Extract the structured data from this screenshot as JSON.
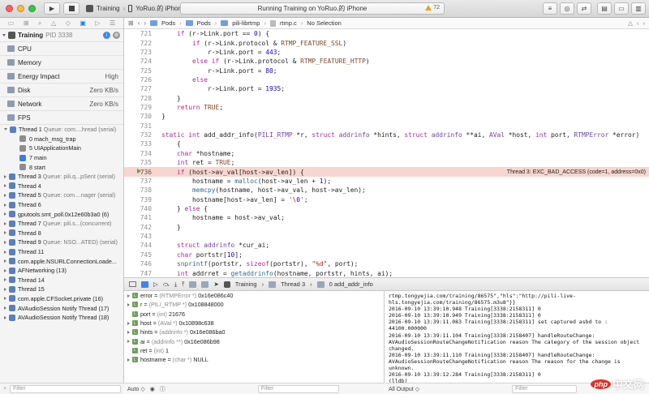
{
  "toolbar": {
    "scheme": "Training",
    "device": "YoRuo.的 iPhone",
    "status": "Running Training on YoRuo.的 iPhone",
    "warnings": "72"
  },
  "sidebar": {
    "process_name": "Training",
    "process_pid": "PID 3338",
    "gauges": [
      {
        "label": "CPU",
        "value": ""
      },
      {
        "label": "Memory",
        "value": ""
      },
      {
        "label": "Energy Impact",
        "value": "High"
      },
      {
        "label": "Disk",
        "value": "Zero KB/s"
      },
      {
        "label": "Network",
        "value": "Zero KB/s"
      },
      {
        "label": "FPS",
        "value": ""
      }
    ],
    "thread1": {
      "label": "Thread 1",
      "queue": "Queue: com....hread (serial)"
    },
    "frames": [
      {
        "label": "0 mach_msg_trap"
      },
      {
        "label": "5 UIApplicationMain"
      },
      {
        "label": "7 main"
      },
      {
        "label": "8 start"
      }
    ],
    "threads": [
      {
        "label": "Thread 3",
        "queue": "Queue: pili.q...pSent (serial)"
      },
      {
        "label": "Thread 4",
        "queue": ""
      },
      {
        "label": "Thread 5",
        "queue": "Queue: com....nager (serial)"
      },
      {
        "label": "Thread 6",
        "queue": ""
      },
      {
        "label": "gputools.smt_poll.0x12e60b3a0 (6)",
        "queue": ""
      },
      {
        "label": "Thread 7",
        "queue": "Queue: pili.s...(concurrent)"
      },
      {
        "label": "Thread 8",
        "queue": ""
      },
      {
        "label": "Thread 9",
        "queue": "Queue: NSO...ATED) (serial)"
      },
      {
        "label": "Thread 11",
        "queue": ""
      },
      {
        "label": "com.apple.NSURLConnectionLoade...",
        "queue": ""
      },
      {
        "label": "AFNetworking (13)",
        "queue": ""
      },
      {
        "label": "Thread 14",
        "queue": ""
      },
      {
        "label": "Thread 15",
        "queue": ""
      },
      {
        "label": "com.apple.CFSocket.private (16)",
        "queue": ""
      },
      {
        "label": "AVAudioSession Notify Thread (17)",
        "queue": ""
      },
      {
        "label": "AVAudioSession Notify Thread (18)",
        "queue": ""
      }
    ],
    "filter_placeholder": "Filter"
  },
  "jumpbar": {
    "path": [
      "Pods",
      "Pods",
      "pili-librtmp",
      "rtmp.c",
      "No Selection"
    ]
  },
  "code": {
    "crash_note": "Thread 3: EXC_BAD_ACCESS (code=1, address=0x0)",
    "lines": [
      {
        "n": "721",
        "t": "    if (r->Link.port == 0) {"
      },
      {
        "n": "722",
        "t": "        if (r->Link.protocol & RTMP_FEATURE_SSL)"
      },
      {
        "n": "723",
        "t": "            r->Link.port = 443;"
      },
      {
        "n": "724",
        "t": "        else if (r->Link.protocol & RTMP_FEATURE_HTTP)"
      },
      {
        "n": "725",
        "t": "            r->Link.port = 80;"
      },
      {
        "n": "726",
        "t": "        else"
      },
      {
        "n": "727",
        "t": "            r->Link.port = 1935;"
      },
      {
        "n": "728",
        "t": "    }"
      },
      {
        "n": "729",
        "t": "    return TRUE;"
      },
      {
        "n": "730",
        "t": "}"
      },
      {
        "n": "731",
        "t": ""
      },
      {
        "n": "732",
        "t": "static int add_addr_info(PILI_RTMP *r, struct addrinfo *hints, struct addrinfo **ai, AVal *host, int port, RTMPError *error)"
      },
      {
        "n": "733",
        "t": "    {"
      },
      {
        "n": "734",
        "t": "    char *hostname;"
      },
      {
        "n": "735",
        "t": "    int ret = TRUE;"
      },
      {
        "n": "736",
        "t": "    if (host->av_val[host->av_len]) {"
      },
      {
        "n": "737",
        "t": "        hostname = malloc(host->av_len + 1);"
      },
      {
        "n": "738",
        "t": "        memcpy(hostname, host->av_val, host->av_len);"
      },
      {
        "n": "739",
        "t": "        hostname[host->av_len] = '\\0';"
      },
      {
        "n": "740",
        "t": "    } else {"
      },
      {
        "n": "741",
        "t": "        hostname = host->av_val;"
      },
      {
        "n": "742",
        "t": "    }"
      },
      {
        "n": "743",
        "t": ""
      },
      {
        "n": "744",
        "t": "    struct addrinfo *cur_ai;"
      },
      {
        "n": "745",
        "t": "    char portstr[10];"
      },
      {
        "n": "746",
        "t": "    snprintf(portstr, sizeof(portstr), \"%d\", port);"
      },
      {
        "n": "747",
        "t": "    int addrret = getaddrinfo(hostname, portstr, hints, ai);"
      },
      {
        "n": "748",
        "t": "    if (addrret != 0) {"
      },
      {
        "n": "749",
        "t": "        char msg[100];"
      },
      {
        "n": "750",
        "t": "        memset(msg, 0, 100);"
      },
      {
        "n": "751",
        "t": "        strcat(msg, \"Problem accessing the DNS. addr: \");"
      },
      {
        "n": "752",
        "t": "        strcat(msg, hostname);"
      }
    ]
  },
  "debugbar": {
    "crumbs": [
      "Training",
      "Thread 3",
      "0 add_addr_info"
    ]
  },
  "variables": [
    {
      "name": "error",
      "type": "(RTMPError *)",
      "value": "0x16e086c40",
      "expand": true
    },
    {
      "name": "r",
      "type": "(PILI_RTMP *)",
      "value": "0x108848000",
      "expand": true
    },
    {
      "name": "port",
      "type": "(int)",
      "value": "21676",
      "expand": false
    },
    {
      "name": "host",
      "type": "(AVal *)",
      "value": "0x10898c638",
      "expand": true
    },
    {
      "name": "hints",
      "type": "(addrinfo *)",
      "value": "0x16e086ba0",
      "expand": true
    },
    {
      "name": "ai",
      "type": "(addrinfo **)",
      "value": "0x16e086b98",
      "expand": true
    },
    {
      "name": "ret",
      "type": "(int)",
      "value": "1",
      "expand": false
    },
    {
      "name": "hostname",
      "type": "(char *)",
      "value": "NULL",
      "expand": true
    }
  ],
  "vars_footer": {
    "mode": "Auto ◇",
    "filter": "Filter"
  },
  "console": {
    "text": "rtmp.tongyejia.com/training/86575\",\"hls\":\"http://pili-live-hls.tongyejia.com/training/86575.m3u8\"}}\n2016-09-10 13:39:10.948 Training[3338:2158311] 0\n2016-09-10 13:39:10.949 Training[3338:2158311] 0\n2016-09-10 13:39:11.083 Training[3338:2158311] set captured asbd to :\n44100.000000\n2016-09-10 13:39:11.104 Training[3338:2158407] handleRouteChange:\nAVAudioSessionRouteChangeNotification reason The category of the session object changed.\n2016-09-10 13:39:11.110 Training[3338:2158407] handleRouteChange:\nAVAudioSessionRouteChangeNotification reason The reason for the change is unknown.\n2016-09-10 13:39:12.284 Training[3338:2158311] 0\n(lldb)"
  },
  "console_footer": {
    "output": "All Output ◇"
  },
  "watermark": {
    "logo": "php",
    "text": "中文网"
  }
}
